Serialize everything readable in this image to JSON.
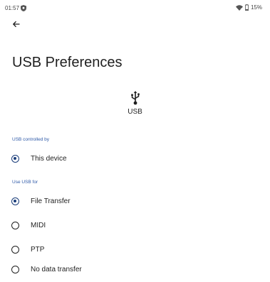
{
  "status_bar": {
    "time": "01:57",
    "battery": "15%",
    "icons": [
      "shield-icon",
      "wifi-icon",
      "battery-icon"
    ]
  },
  "back": {
    "icon": "arrow-left-icon"
  },
  "title": "USB Preferences",
  "usb": {
    "icon": "usb-icon",
    "label": "USB"
  },
  "controlled_by": {
    "header": "USB controlled by",
    "options": [
      {
        "label": "This device",
        "selected": true
      }
    ]
  },
  "use_for": {
    "header": "Use USB for",
    "options": [
      {
        "label": "File Transfer",
        "selected": true
      },
      {
        "label": "MIDI",
        "selected": false
      },
      {
        "label": "PTP",
        "selected": false
      },
      {
        "label": "No data transfer",
        "selected": false
      }
    ]
  },
  "colors": {
    "accent": "#1a3d7a",
    "section_header": "#2f5aa8"
  }
}
